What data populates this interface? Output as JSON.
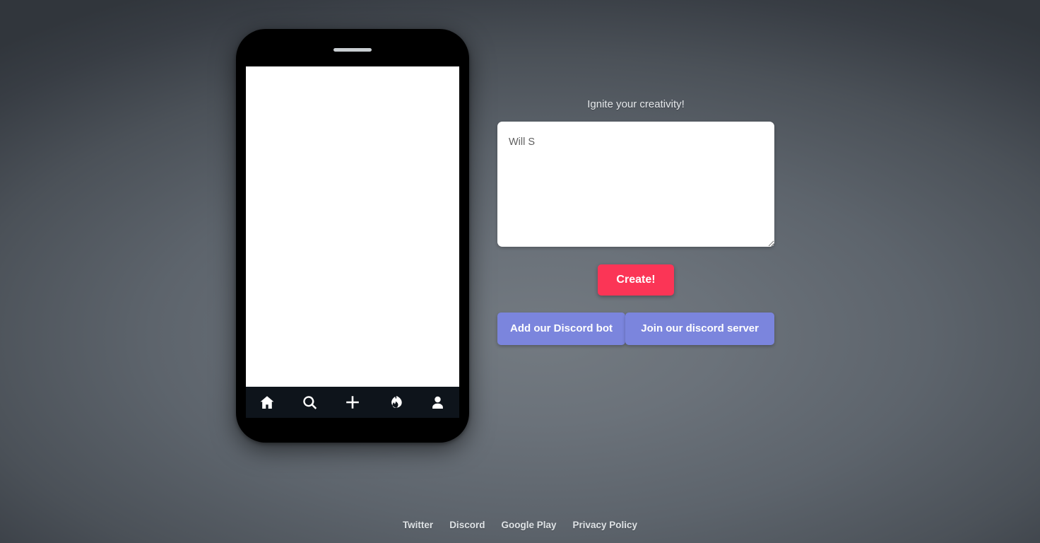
{
  "theme": {
    "background_dark": "#31363c",
    "background_light": "#737a81",
    "create_button_color": "#fb3556",
    "discord_button_color": "#7b85dd",
    "phone_bezel_color": "#000000",
    "phone_navbar_color": "#0e141b",
    "screen_color": "#ffffff"
  },
  "phone": {
    "speaker_name": "phone-speaker-grille",
    "screen_content": "",
    "navbar": {
      "items": [
        {
          "icon": "home-icon",
          "name": "nav-home"
        },
        {
          "icon": "search-icon",
          "name": "nav-search"
        },
        {
          "icon": "plus-icon",
          "name": "nav-create"
        },
        {
          "icon": "flame-icon",
          "name": "nav-trending"
        },
        {
          "icon": "person-icon",
          "name": "nav-profile"
        }
      ]
    }
  },
  "panel": {
    "heading": "Ignite your creativity!",
    "prompt": {
      "value": "Will S",
      "placeholder": ""
    },
    "create_label": "Create!",
    "discord_bot_label": "Add our Discord bot",
    "discord_server_label": "Join our discord server"
  },
  "footer": {
    "links": [
      {
        "label": "Twitter"
      },
      {
        "label": "Discord"
      },
      {
        "label": "Google Play"
      },
      {
        "label": "Privacy Policy"
      }
    ]
  }
}
